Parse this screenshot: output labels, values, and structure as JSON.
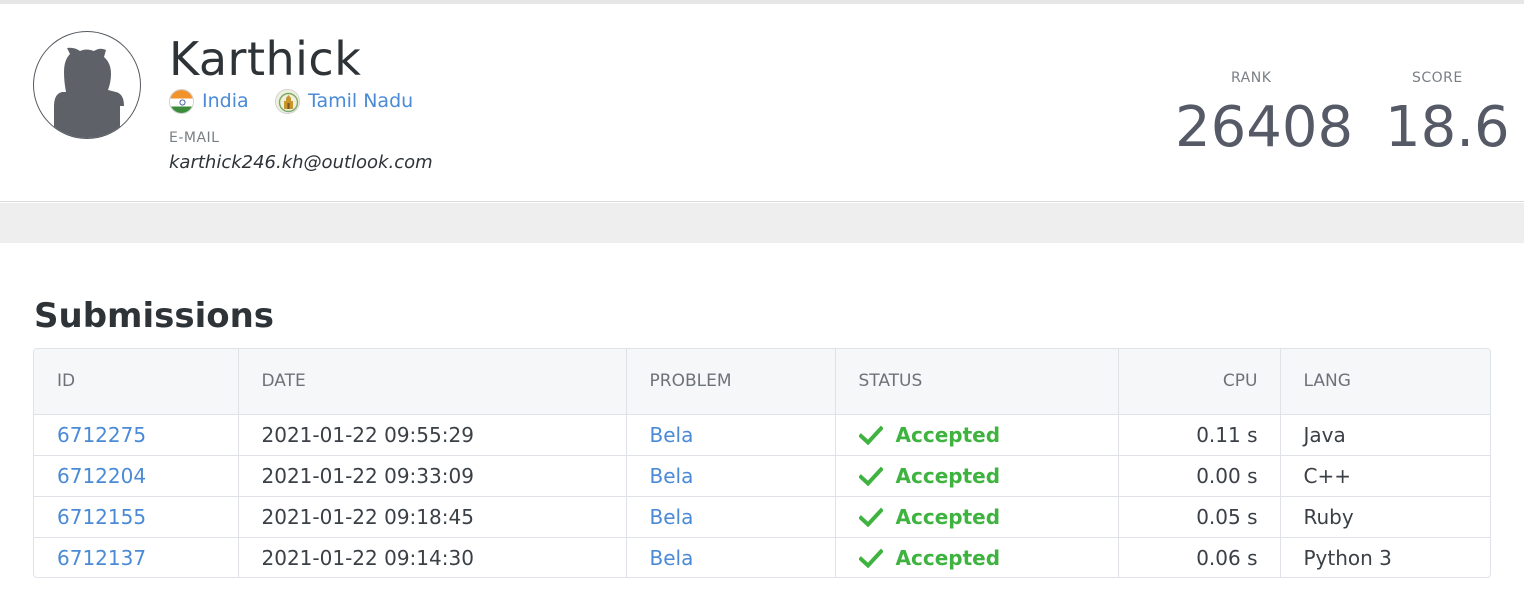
{
  "profile": {
    "name": "Karthick",
    "country": "India",
    "region": "Tamil Nadu",
    "email_label": "E-MAIL",
    "email": "karthick246.kh@outlook.com"
  },
  "stats": {
    "rank_label": "RANK",
    "rank_value": "26408",
    "score_label": "SCORE",
    "score_value": "18.6"
  },
  "submissions": {
    "title": "Submissions",
    "columns": [
      "ID",
      "DATE",
      "PROBLEM",
      "STATUS",
      "CPU",
      "LANG"
    ],
    "rows": [
      {
        "id": "6712275",
        "date": "2021-01-22 09:55:29",
        "problem": "Bela",
        "status": "Accepted",
        "cpu": "0.11 s",
        "lang": "Java"
      },
      {
        "id": "6712204",
        "date": "2021-01-22 09:33:09",
        "problem": "Bela",
        "status": "Accepted",
        "cpu": "0.00 s",
        "lang": "C++"
      },
      {
        "id": "6712155",
        "date": "2021-01-22 09:18:45",
        "problem": "Bela",
        "status": "Accepted",
        "cpu": "0.05 s",
        "lang": "Ruby"
      },
      {
        "id": "6712137",
        "date": "2021-01-22 09:14:30",
        "problem": "Bela",
        "status": "Accepted",
        "cpu": "0.06 s",
        "lang": "Python 3"
      }
    ]
  },
  "colors": {
    "link": "#4a8ad6",
    "accepted": "#3fb33f",
    "text": "#2e3338"
  },
  "icons": {
    "avatar": "default-avatar-icon",
    "country_flag": "india-flag-icon",
    "region_emblem": "tamil-nadu-emblem-icon",
    "status": "checkmark-icon"
  }
}
